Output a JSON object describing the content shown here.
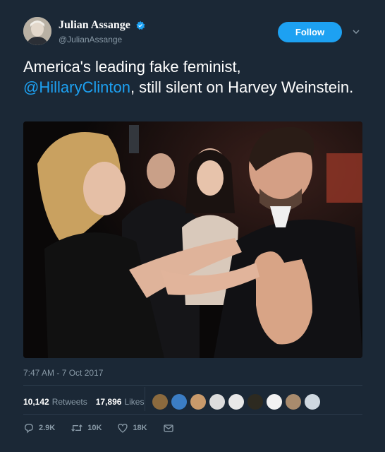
{
  "author": {
    "display_name": "Julian Assange",
    "handle": "@JulianAssange",
    "verified": true
  },
  "follow_button": {
    "label": "Follow"
  },
  "tweet": {
    "text_part1": "America's leading fake feminist,",
    "mention": "@HillaryClinton",
    "text_part2": ", still silent on Harvey Weinstein."
  },
  "timestamp": "7:47 AM - 7 Oct 2017",
  "stats": {
    "retweets_count": "10,142",
    "retweets_label": "Retweets",
    "likes_count": "17,896",
    "likes_label": "Likes"
  },
  "liker_avatars": [
    {
      "icon": "avatar-1",
      "color": "#8b6a3e"
    },
    {
      "icon": "avatar-2",
      "color": "#3b7dc4"
    },
    {
      "icon": "avatar-3",
      "color": "#c99a6b"
    },
    {
      "icon": "avatar-4",
      "color": "#dcdcdc"
    },
    {
      "icon": "avatar-5",
      "color": "#e8e8e8"
    },
    {
      "icon": "avatar-6",
      "color": "#2d2a20"
    },
    {
      "icon": "avatar-7",
      "color": "#f2f2f2"
    },
    {
      "icon": "avatar-8",
      "color": "#a88b6d"
    },
    {
      "icon": "avatar-9",
      "color": "#cfd8e0"
    }
  ],
  "actions": {
    "replies": "2.9K",
    "retweets": "10K",
    "likes": "18K"
  },
  "colors": {
    "background": "#1b2836",
    "accent": "#1da1f2",
    "muted": "#8899a6"
  }
}
